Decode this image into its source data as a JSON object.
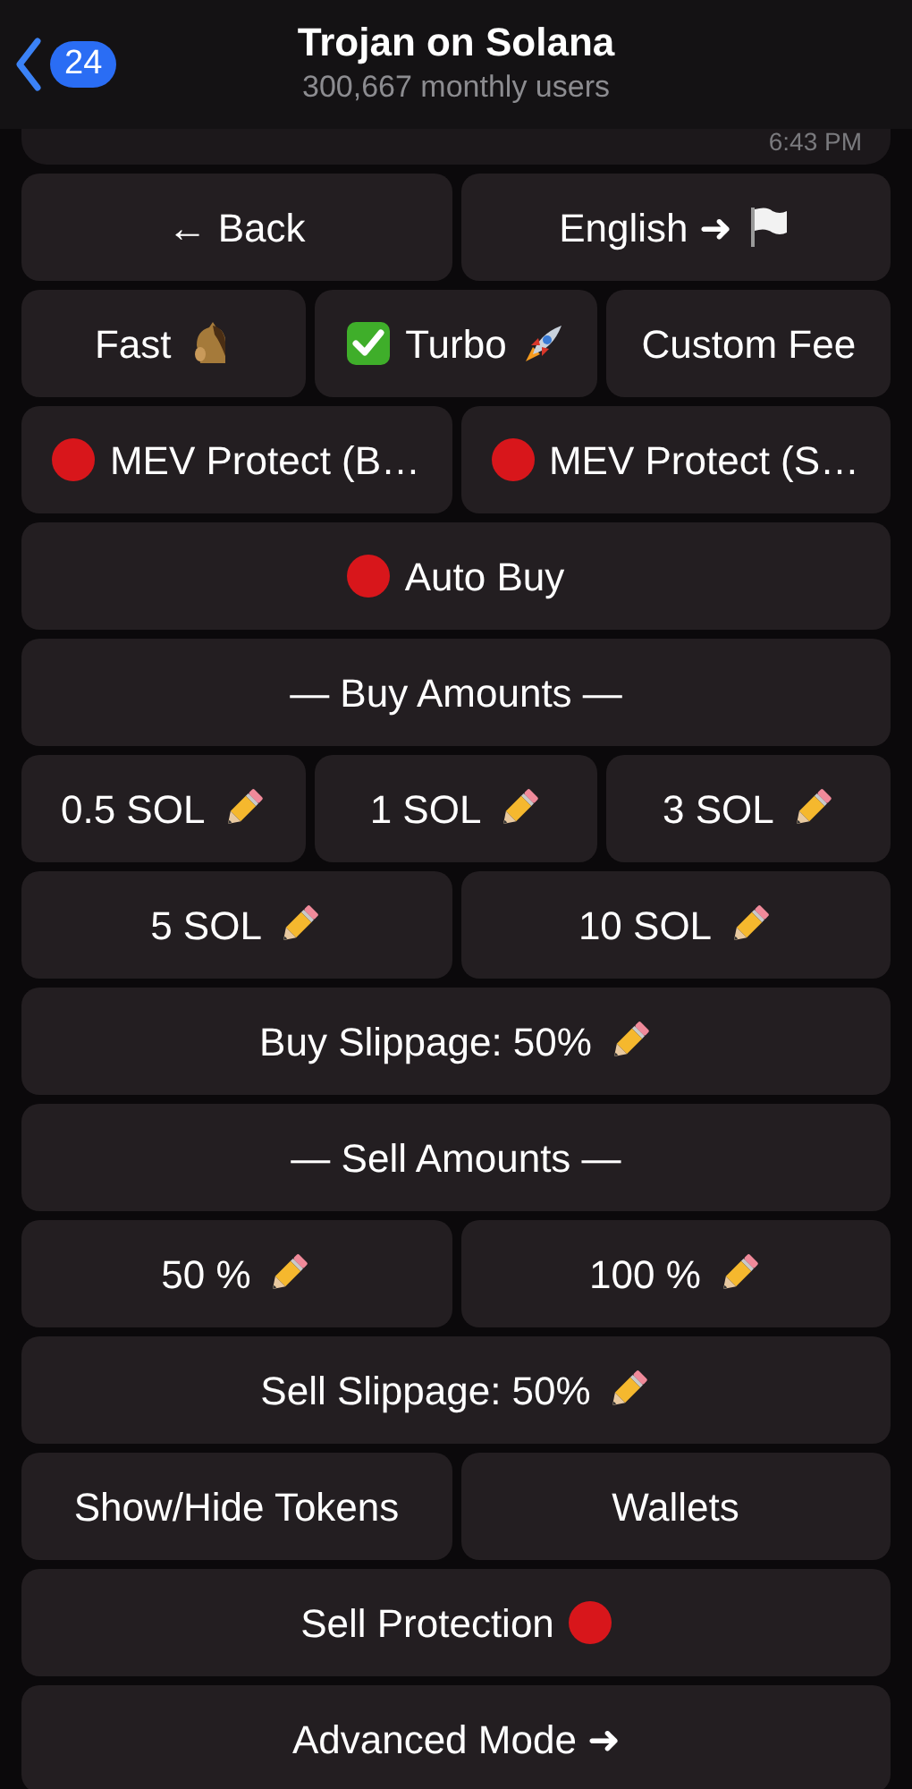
{
  "header": {
    "back_count": "24",
    "title": "Trojan on Solana",
    "subtitle": "300,667 monthly users"
  },
  "message": {
    "time": "6:43 PM"
  },
  "rows": [
    [
      {
        "label": "← Back",
        "kind": "plain"
      },
      {
        "label": "English ➜",
        "kind": "language"
      }
    ],
    [
      {
        "label": "Fast",
        "kind": "fast",
        "selected": false
      },
      {
        "label": "Turbo",
        "kind": "turbo",
        "selected": true
      },
      {
        "label": "Custom Fee",
        "kind": "plain"
      }
    ],
    [
      {
        "label": "MEV Protect (B…",
        "on": false,
        "kind": "toggle"
      },
      {
        "label": "MEV Protect (S…",
        "on": false,
        "kind": "toggle"
      }
    ],
    [
      {
        "label": "Auto Buy",
        "on": false,
        "kind": "toggle"
      }
    ],
    [
      {
        "label": "— Buy Amounts —",
        "kind": "plain"
      }
    ],
    [
      {
        "label": "0.5 SOL",
        "kind": "editable"
      },
      {
        "label": "1 SOL",
        "kind": "editable"
      },
      {
        "label": "3 SOL",
        "kind": "editable"
      }
    ],
    [
      {
        "label": "5 SOL",
        "kind": "editable"
      },
      {
        "label": "10 SOL",
        "kind": "editable"
      }
    ],
    [
      {
        "label": "Buy Slippage: 50%",
        "kind": "editable"
      }
    ],
    [
      {
        "label": "— Sell Amounts —",
        "kind": "plain"
      }
    ],
    [
      {
        "label": "50 %",
        "kind": "editable"
      },
      {
        "label": "100 %",
        "kind": "editable"
      }
    ],
    [
      {
        "label": "Sell Slippage: 50%",
        "kind": "editable"
      }
    ],
    [
      {
        "label": "Show/Hide Tokens",
        "kind": "plain"
      },
      {
        "label": "Wallets",
        "kind": "plain"
      }
    ],
    [
      {
        "label": "Sell Protection",
        "on": false,
        "kind": "trailing-toggle"
      }
    ],
    [
      {
        "label": "Advanced Mode ➜",
        "kind": "plain"
      }
    ]
  ]
}
